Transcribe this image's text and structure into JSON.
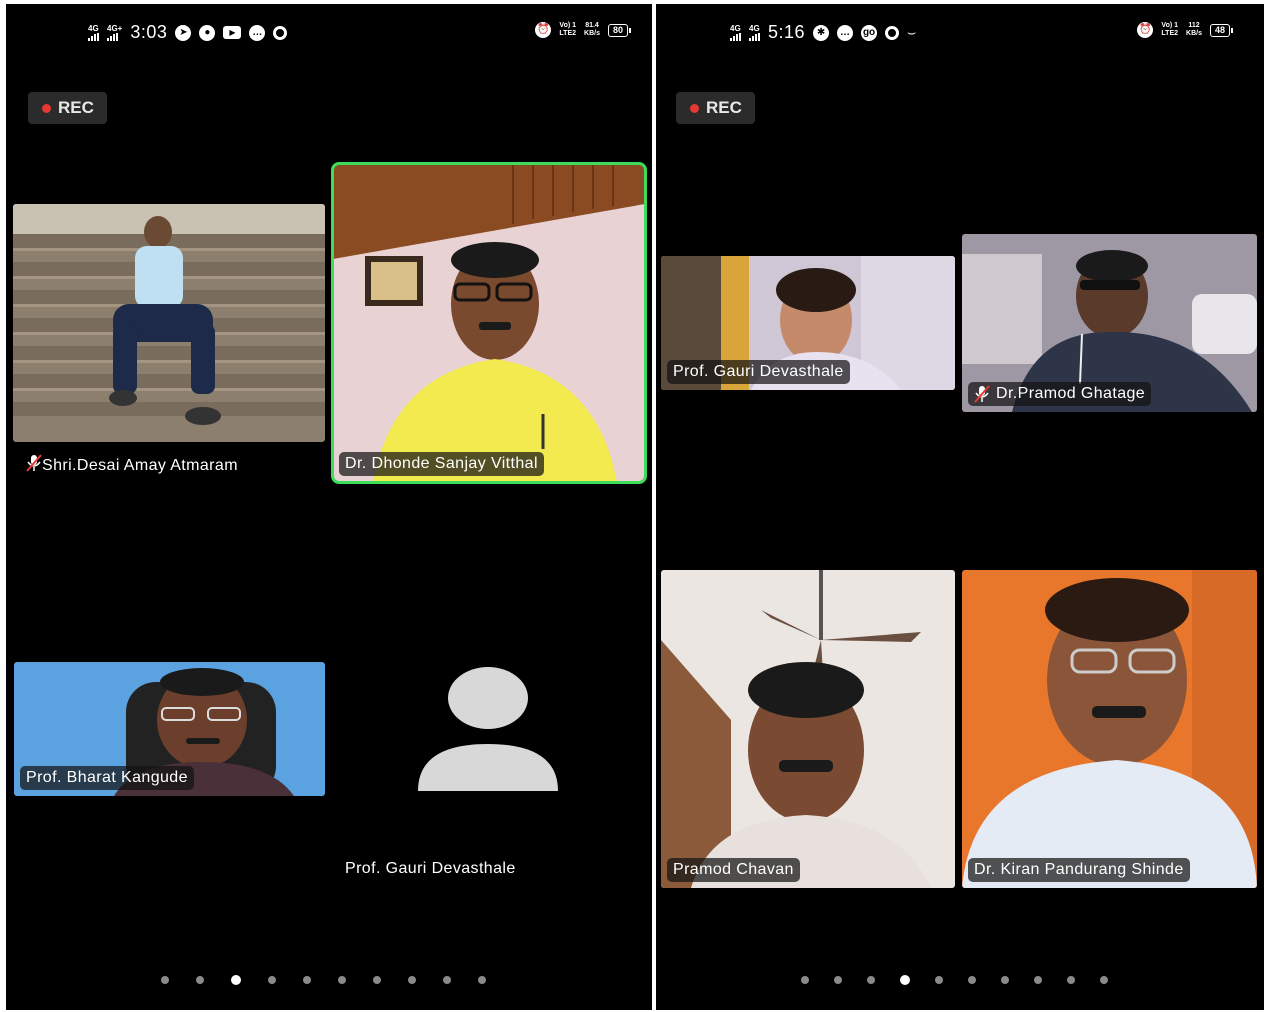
{
  "left_screen": {
    "status_bar": {
      "network_1": "4G",
      "network_2": "4G+",
      "time": "3:03",
      "volte_top": "Vo) 1",
      "volte_bottom": "LTE2",
      "net_speed_value": "81.4",
      "net_speed_unit": "KB/s",
      "battery": "80"
    },
    "rec_label": "REC",
    "participants": [
      {
        "name": "Shri.Desai Amay Atmaram",
        "muted": true
      },
      {
        "name": "Dr. Dhonde Sanjay Vitthal",
        "muted": false,
        "active_speaker": true
      },
      {
        "name": "Prof. Bharat Kangude",
        "muted": false
      },
      {
        "name": "Prof. Gauri Devasthale",
        "muted": false,
        "video": false
      }
    ],
    "page_indicator": {
      "count": 10,
      "current": 3
    }
  },
  "right_screen": {
    "status_bar": {
      "network_1": "4G",
      "network_2": "4G",
      "time": "5:16",
      "volte_top": "Vo) 1",
      "volte_bottom": "LTE2",
      "net_speed_value": "112",
      "net_speed_unit": "KB/s",
      "battery": "48"
    },
    "rec_label": "REC",
    "participants": [
      {
        "name": "Prof. Gauri Devasthale",
        "muted": false
      },
      {
        "name": "Dr.Pramod Ghatage",
        "muted": true
      },
      {
        "name": "Pramod Chavan",
        "muted": false
      },
      {
        "name": "Dr. Kiran Pandurang Shinde",
        "muted": false
      }
    ],
    "page_indicator": {
      "count": 10,
      "current": 4
    }
  },
  "colors": {
    "active_border": "#3ddc5a",
    "rec_dot": "#e53935",
    "background": "#000000"
  }
}
